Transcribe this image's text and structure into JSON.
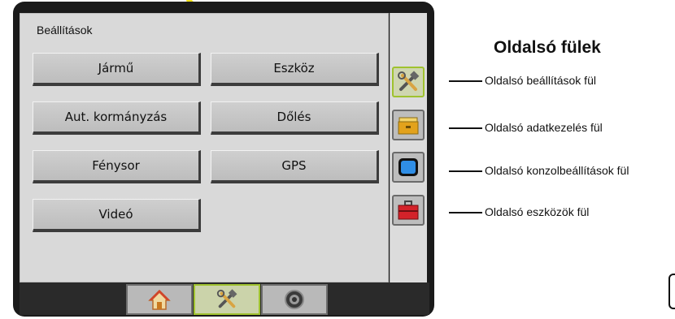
{
  "panel": {
    "title": "Beállítások"
  },
  "buttons": [
    {
      "label": "Jármű"
    },
    {
      "label": "Eszköz"
    },
    {
      "label": "Aut. kormányzás"
    },
    {
      "label": "Dőlés"
    },
    {
      "label": "Fénysor"
    },
    {
      "label": "GPS"
    },
    {
      "label": "Videó"
    }
  ],
  "side_tabs": [
    {
      "icon": "tools-icon",
      "active": true
    },
    {
      "icon": "data-management-icon",
      "active": false
    },
    {
      "icon": "console-icon",
      "active": false
    },
    {
      "icon": "toolbox-icon",
      "active": false
    }
  ],
  "bottom_tabs": [
    {
      "icon": "home-icon",
      "active": false
    },
    {
      "icon": "tools-icon",
      "active": true
    },
    {
      "icon": "gauge-icon",
      "active": false
    }
  ],
  "annotation": {
    "heading": "Oldalsó fülek",
    "labels": [
      "Oldalsó beállítások fül",
      "Oldalsó adatkezelés fül",
      "Oldalsó konzolbeállítások fül",
      "Oldalsó eszközök fül"
    ]
  },
  "colors": {
    "active_highlight": "#9fc22f",
    "pointer": "#f2e21c",
    "panel_bg": "#d9d9d9",
    "frame": "#1a1a1a"
  }
}
